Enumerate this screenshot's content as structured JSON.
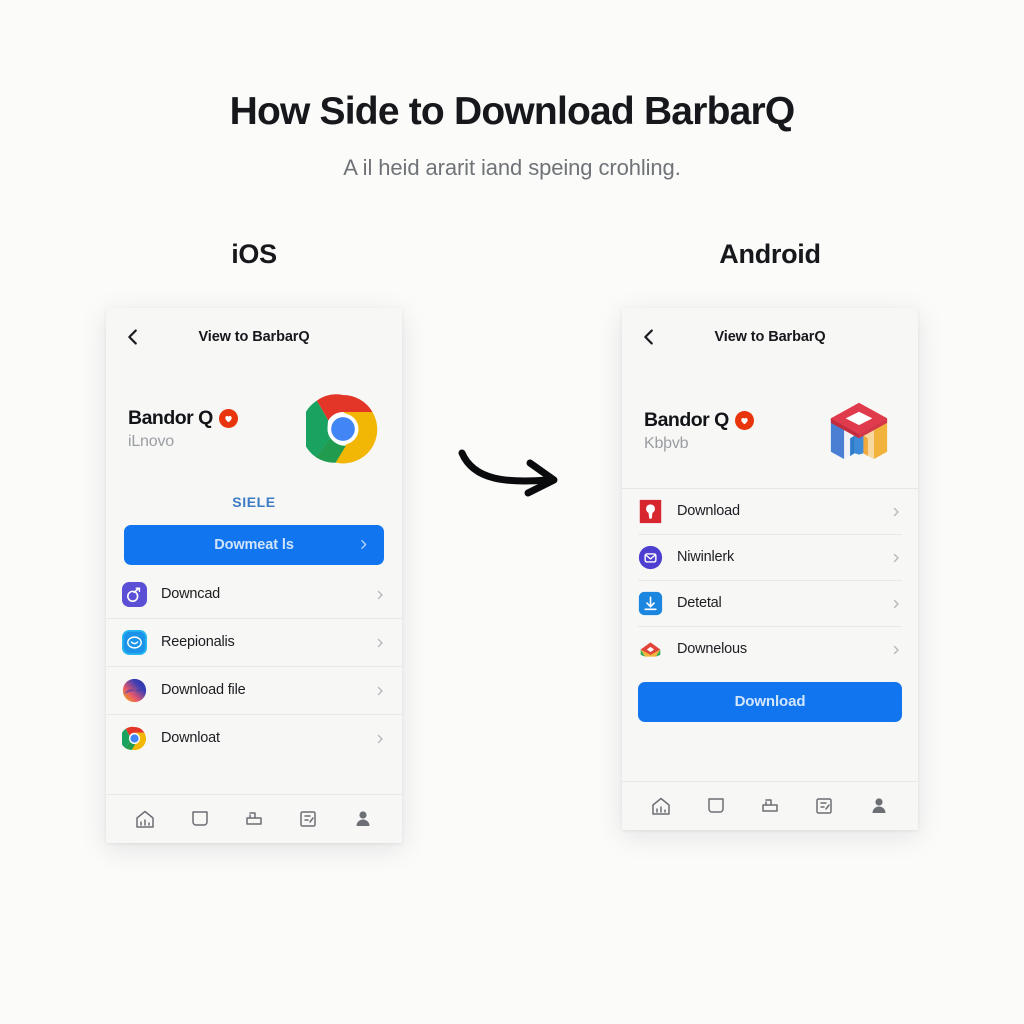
{
  "header": {
    "title": "How Side to Download BarbarQ",
    "subtitle": "A il heid ararit iand speing crohling."
  },
  "flow": {
    "arrow_icon": "curved-right-arrow"
  },
  "colors": {
    "page_bg": "#fbfbfa",
    "phone_bg": "#f7f7f6",
    "accent_blue": "#1275f0",
    "link_blue": "#3b7cc4",
    "badge_red": "#e8350d",
    "title_text": "#16181c",
    "subtitle_text": "#6f7378"
  },
  "platforms": [
    {
      "label": "iOS",
      "nav": {
        "back_icon": "chevron-left-icon",
        "title": "View to BarbarQ"
      },
      "app": {
        "name": "Bandor Q",
        "badge_icon": "heart-badge-icon",
        "subtitle": "iLnovo",
        "logo_icon": "chrome-logo-icon"
      },
      "link_label": "SIELE",
      "cta": {
        "label": "Dowmeat ls",
        "chevron_icon": "chevron-right-icon"
      },
      "rows": [
        {
          "label": "Downcad",
          "icon": "purple-app-icon",
          "chevron_icon": "chevron-right-icon"
        },
        {
          "label": "Reepionalis",
          "icon": "cyan-app-icon",
          "chevron_icon": "chevron-right-icon"
        },
        {
          "label": "Download file",
          "icon": "gradient-sphere-icon",
          "chevron_icon": "chevron-right-icon"
        },
        {
          "label": "Downloat",
          "icon": "chrome-logo-icon",
          "chevron_icon": "chevron-right-icon"
        }
      ],
      "tabs": [
        "home-icon",
        "chat-bubble-icon",
        "cart-icon",
        "card-icon",
        "person-icon"
      ]
    },
    {
      "label": "Android",
      "nav": {
        "back_icon": "chevron-left-icon",
        "title": "View to BarbarQ"
      },
      "app": {
        "name": "Bandor Q",
        "badge_icon": "heart-badge-icon",
        "subtitle": "Kbþvb",
        "logo_icon": "play-store-box-icon"
      },
      "rows": [
        {
          "label": "Download",
          "icon": "red-keyhole-icon",
          "chevron_icon": "chevron-right-icon"
        },
        {
          "label": "Niwinlerk",
          "icon": "purple-circle-icon",
          "chevron_icon": "chevron-right-icon"
        },
        {
          "label": "Detetal",
          "icon": "blue-square-icon",
          "chevron_icon": "chevron-right-icon"
        },
        {
          "label": "Downelous",
          "icon": "gmail-box-icon",
          "chevron_icon": "chevron-right-icon"
        }
      ],
      "cta": {
        "label": "Download"
      },
      "tabs": [
        "home-icon",
        "chat-bubble-icon",
        "cart-icon",
        "card-icon",
        "person-icon"
      ]
    }
  ]
}
